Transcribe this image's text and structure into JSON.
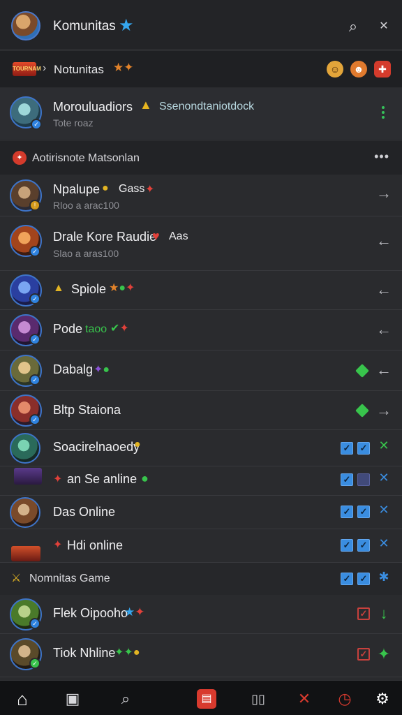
{
  "header": {
    "title": "Komunitas",
    "title_star": "★",
    "search_icon": "⌕",
    "close_icon": "✕"
  },
  "subheader": {
    "logo_text": "TOURNAM",
    "chevron": "›",
    "label": "Notunitas",
    "decor": "★✦",
    "icons": [
      "☺",
      "☻",
      "✚"
    ]
  },
  "featured": {
    "name": "Morouluadiors",
    "trophy": "🔔",
    "tag": "Ssenondtaniotdock",
    "subtitle": "Tote roaz"
  },
  "section1": {
    "label": "Aotirisnote Matsonlan",
    "more": "•••",
    "icon": "✦"
  },
  "list1": [
    {
      "name": "Npalupe",
      "suffix": "Gass",
      "subtitle": "Rloo a arac100",
      "trail": "→",
      "accent": "#d4a400"
    },
    {
      "name": "Drale Kore Raudie",
      "suffix": "Aas",
      "subtitle": "Slao a aras100",
      "trail": "←",
      "accent": "#e2413a"
    },
    {
      "name": "Spiole",
      "suffix": "",
      "subtitle": "",
      "trail": "←",
      "accent": "#e39c1a"
    },
    {
      "name": "Pode",
      "suffix": "taoo",
      "subtitle": "",
      "trail": "←",
      "accent": "#38c44c"
    },
    {
      "name": "Dabalg",
      "suffix": "",
      "subtitle": "",
      "trail": "←",
      "accent": "#8a52d6"
    },
    {
      "name": "Bltp Staiona",
      "suffix": "",
      "subtitle": "",
      "trail": "→",
      "accent": "#e39c1a"
    }
  ],
  "list2": [
    {
      "name": "Soacirelnaoedy",
      "trail": "✕"
    },
    {
      "name": "an Se anline",
      "trail": "✕"
    },
    {
      "name": "Das Online",
      "trail": "✕"
    },
    {
      "name": "Hdi online",
      "trail": "✕"
    }
  ],
  "section2": {
    "label": "Nomnitas Game",
    "icon": "⚔"
  },
  "list3": [
    {
      "name": "Flek Oipooho",
      "trail": "↓"
    },
    {
      "name": "Tiok Nhline",
      "trail": "✦"
    }
  ],
  "bottom_nav": [
    "⌂",
    "▣",
    "⌕",
    "▤",
    "▯▯",
    "✕",
    "◷",
    "⚙"
  ],
  "colors": {
    "accent_blue": "#2f83e0",
    "green": "#38c44c",
    "red": "#e2413a"
  }
}
